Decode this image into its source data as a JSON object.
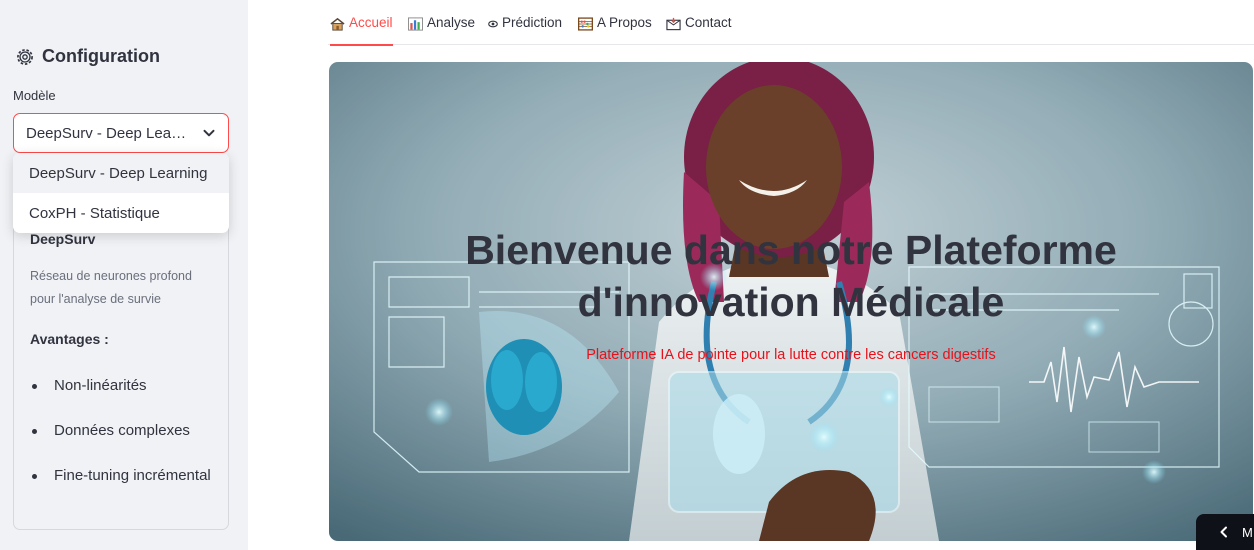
{
  "sidebar": {
    "title": "Configuration",
    "model_label": "Modèle",
    "selected_value": "DeepSurv - Deep Lea…",
    "options": [
      "DeepSurv - Deep Learning",
      "CoxPH - Statistique"
    ],
    "info": {
      "title": "DeepSurv",
      "description": "Réseau de neurones profond pour l'analyse de survie",
      "advantages_title": "Avantages :",
      "advantages": [
        "Non-linéarités",
        "Données complexes",
        "Fine-tuning incrémental"
      ]
    }
  },
  "tabs": [
    {
      "label": "Accueil",
      "icon": "house-icon",
      "active": true
    },
    {
      "label": "Analyse",
      "icon": "bar-chart-icon",
      "active": false
    },
    {
      "label": "Prédiction",
      "icon": "eye-icon",
      "active": false
    },
    {
      "label": "A Propos",
      "icon": "abacus-icon",
      "active": false
    },
    {
      "label": "Contact",
      "icon": "envelope-icon",
      "active": false
    }
  ],
  "hero": {
    "title": "Bienvenue dans notre Plateforme d'innovation Médicale",
    "subtitle": "Plateforme IA de pointe pour la lutte contre les cancers digestifs"
  },
  "bottom_button": {
    "label": "M"
  },
  "colors": {
    "accent": "#ff4b4b",
    "subtitle": "#e8111a",
    "sidebar_bg": "#f0f2f6",
    "text": "#31333f"
  }
}
